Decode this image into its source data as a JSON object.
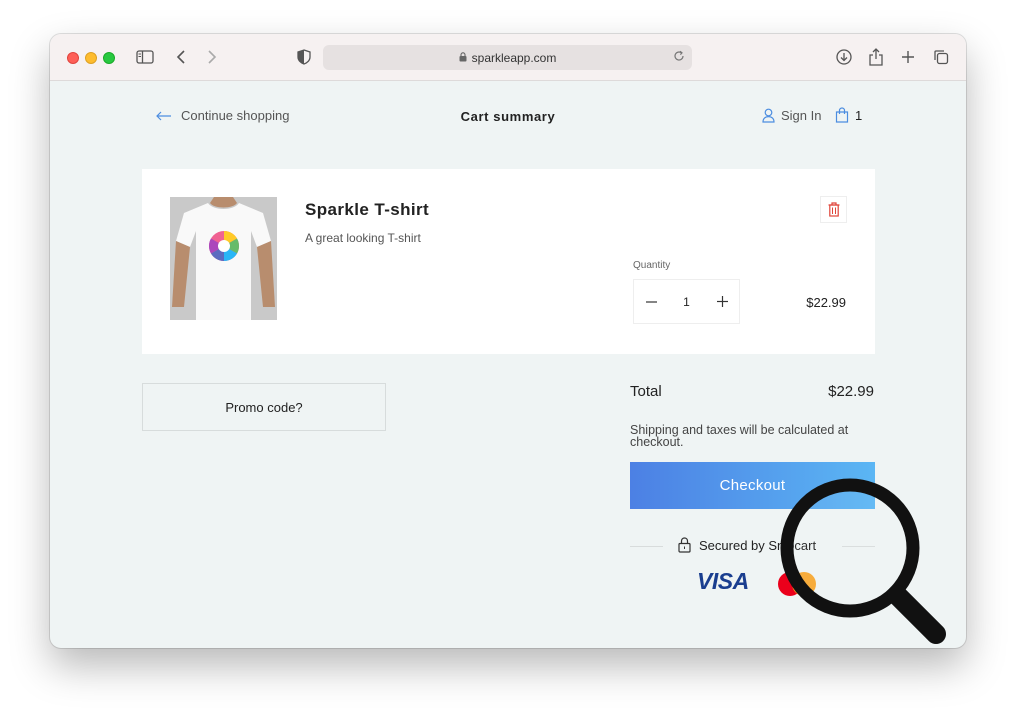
{
  "browser": {
    "url": "sparkleapp.com"
  },
  "nav": {
    "continue_label": "Continue shopping",
    "title": "Cart summary",
    "signin_label": "Sign In",
    "cart_count": "1"
  },
  "cart": {
    "item": {
      "name": "Sparkle T-shirt",
      "description": "A great looking T-shirt",
      "quantity_label": "Quantity",
      "quantity": "1",
      "price": "$22.99"
    }
  },
  "summary": {
    "promo_label": "Promo code?",
    "total_label": "Total",
    "total_value": "$22.99",
    "shipping_note": "Shipping and taxes will be calculated at checkout.",
    "checkout_label": "Checkout",
    "secured_label": "Secured by Snipcart",
    "card_brand": "VISA"
  },
  "colors": {
    "accent_start": "#4c80e4",
    "accent_end": "#5bb6f4",
    "delete": "#e0453a",
    "page_bg": "#eff4f4"
  },
  "icons": {
    "back": "arrow-left-icon",
    "user": "user-icon",
    "bag": "shopping-bag-icon",
    "delete": "trash-icon",
    "lock": "lock-icon",
    "zoom": "magnifier-icon"
  }
}
